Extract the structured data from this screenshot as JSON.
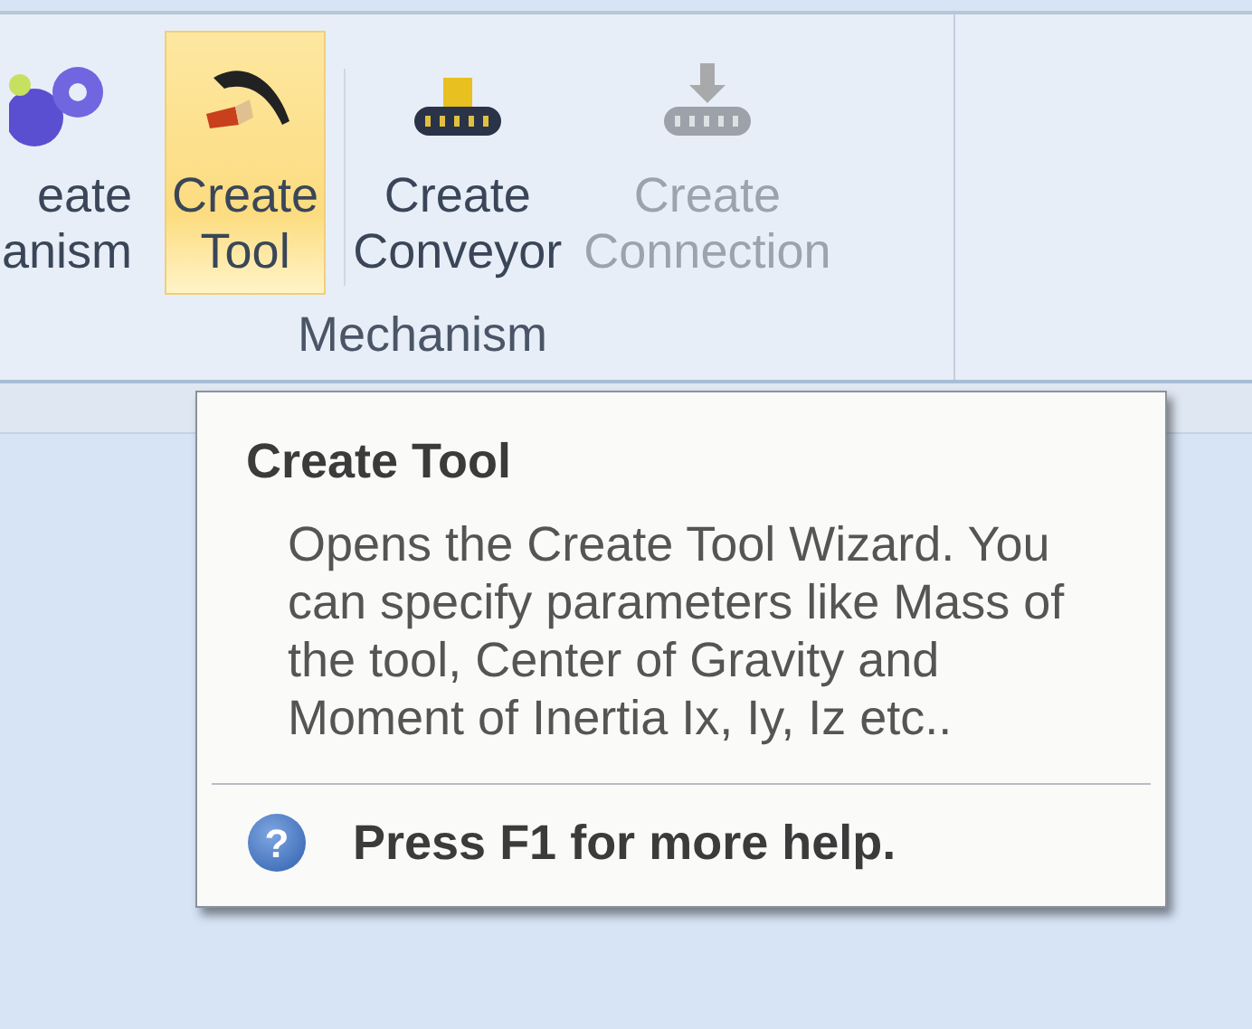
{
  "ribbon": {
    "buttons": [
      {
        "kind": "gears",
        "lines": [
          "eate",
          "anism"
        ],
        "highlighted": false,
        "disabled": false
      },
      {
        "kind": "tool",
        "lines": [
          "Create",
          "Tool"
        ],
        "highlighted": true,
        "disabled": false
      },
      {
        "kind": "conveyor",
        "lines": [
          "Create",
          "Conveyor"
        ],
        "highlighted": false,
        "disabled": false
      },
      {
        "kind": "connection",
        "lines": [
          "Create",
          "Connection"
        ],
        "highlighted": false,
        "disabled": true
      }
    ],
    "group_label": "Mechanism"
  },
  "tooltip": {
    "title": "Create Tool",
    "description": "Opens the Create Tool Wizard. You can specify parameters like Mass of the tool, Center of Gravity and Moment of Inertia Ix, Iy, Iz etc..",
    "help_icon": "?",
    "help": "Press F1 for more help."
  }
}
